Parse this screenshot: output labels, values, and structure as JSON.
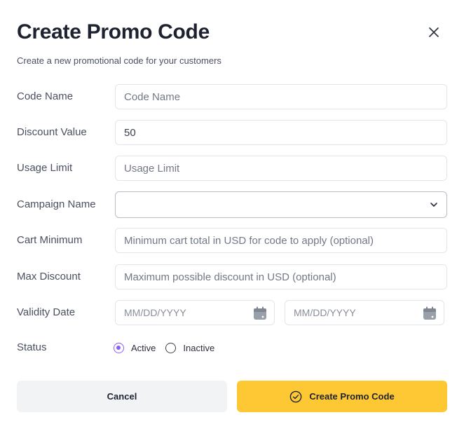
{
  "dialog": {
    "title": "Create Promo Code",
    "subtitle": "Create a new promotional code for your customers",
    "close_icon": "close-icon"
  },
  "fields": {
    "code_name": {
      "label": "Code Name",
      "value": "",
      "placeholder": "Code Name"
    },
    "discount_value": {
      "label": "Discount Value",
      "value": "50",
      "placeholder": ""
    },
    "usage_limit": {
      "label": "Usage Limit",
      "value": "",
      "placeholder": "Usage Limit"
    },
    "campaign_name": {
      "label": "Campaign Name",
      "value": "",
      "icon": "chevron-down-icon"
    },
    "cart_minimum": {
      "label": "Cart Minimum",
      "value": "",
      "placeholder": "Minimum cart total in USD for code to apply (optional)"
    },
    "max_discount": {
      "label": "Max Discount",
      "value": "",
      "placeholder": "Maximum possible discount in USD (optional)"
    },
    "validity_date": {
      "label": "Validity Date",
      "start_placeholder": "MM/DD/YYYY",
      "end_placeholder": "MM/DD/YYYY",
      "icon": "calendar-icon"
    },
    "status": {
      "label": "Status",
      "options": [
        {
          "label": "Active",
          "selected": true
        },
        {
          "label": "Inactive",
          "selected": false
        }
      ]
    }
  },
  "actions": {
    "cancel_label": "Cancel",
    "create_label": "Create Promo Code",
    "create_icon": "check-circle-icon"
  },
  "colors": {
    "primary_button": "#fec734",
    "secondary_button": "#f2f3f5",
    "radio_accent": "#8b5cf6"
  }
}
